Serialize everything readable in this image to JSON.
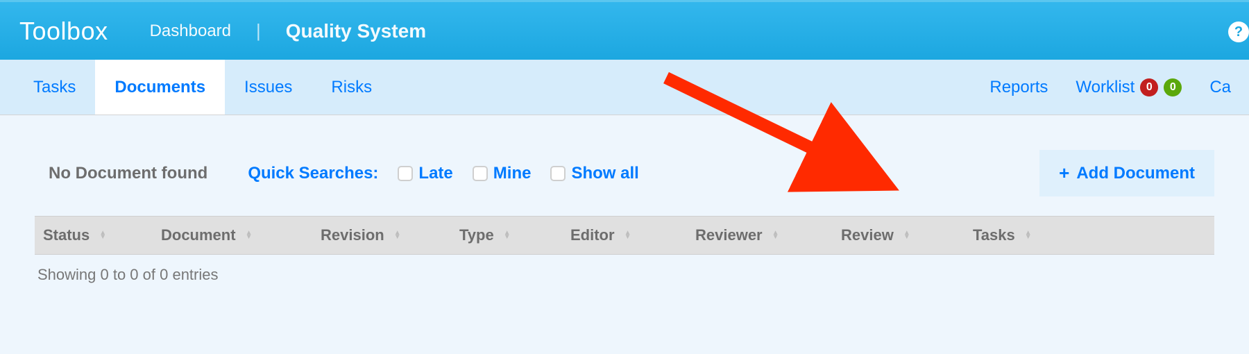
{
  "header": {
    "brand": "Toolbox",
    "nav": {
      "dashboard": "Dashboard",
      "quality_system": "Quality System"
    },
    "help_glyph": "?"
  },
  "subnav": {
    "left": {
      "tasks": "Tasks",
      "documents": "Documents",
      "issues": "Issues",
      "risks": "Risks"
    },
    "right": {
      "reports": "Reports",
      "worklist": "Worklist",
      "worklist_badges": {
        "red": "0",
        "green": "0"
      },
      "extra": "Ca"
    },
    "active": "documents"
  },
  "filters": {
    "not_found": "No Document found",
    "quick_searches_label": "Quick Searches:",
    "late": "Late",
    "mine": "Mine",
    "show_all": "Show all"
  },
  "actions": {
    "add_document": "Add Document"
  },
  "table": {
    "columns": {
      "status": "Status",
      "document": "Document",
      "revision": "Revision",
      "type": "Type",
      "editor": "Editor",
      "reviewer": "Reviewer",
      "review": "Review",
      "tasks": "Tasks"
    },
    "entries_info": "Showing 0 to 0 of 0 entries"
  }
}
